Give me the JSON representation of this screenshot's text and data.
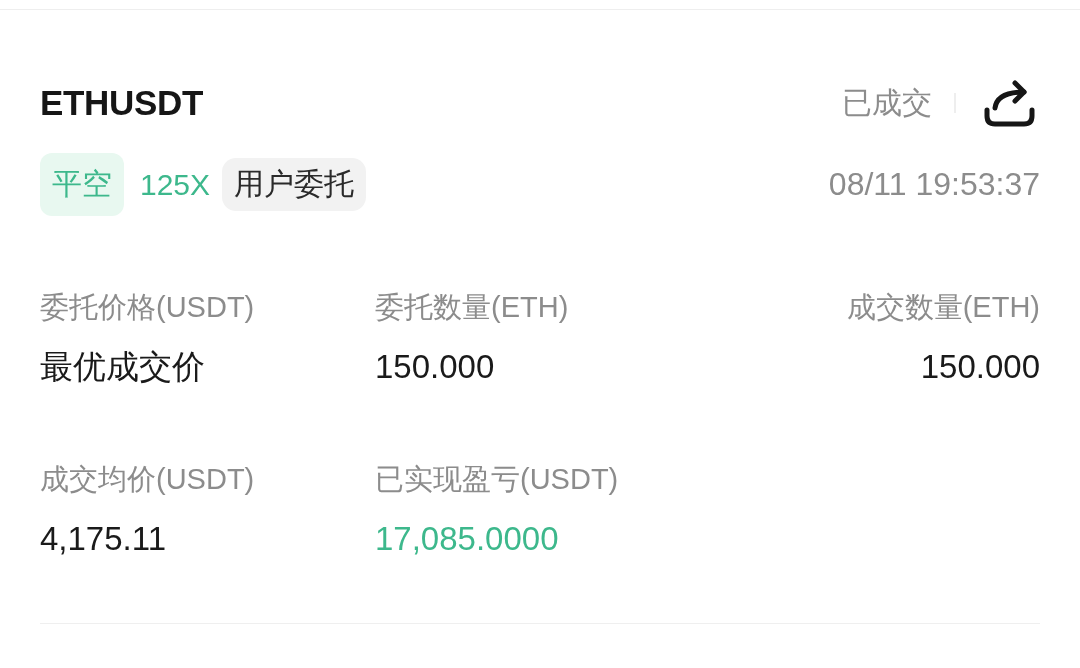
{
  "order": {
    "symbol": "ETHUSDT",
    "status": "已成交",
    "time": "08/11 19:53:37",
    "tags": [
      {
        "text": "平空",
        "kind": "side"
      },
      {
        "text": "125X",
        "kind": "leverage"
      },
      {
        "text": "用户委托",
        "kind": "source"
      }
    ],
    "fields": [
      {
        "label": "委托价格(USDT)",
        "value": "最优成交价",
        "kind": "plain"
      },
      {
        "label": "委托数量(ETH)",
        "value": "150.000",
        "kind": "plain"
      },
      {
        "label": "成交数量(ETH)",
        "value": "150.000",
        "kind": "plain"
      },
      {
        "label": "成交均价(USDT)",
        "value": "4,175.11",
        "kind": "plain"
      },
      {
        "label": "已实现盈亏(USDT)",
        "value": "17,085.0000",
        "kind": "profit"
      }
    ]
  }
}
